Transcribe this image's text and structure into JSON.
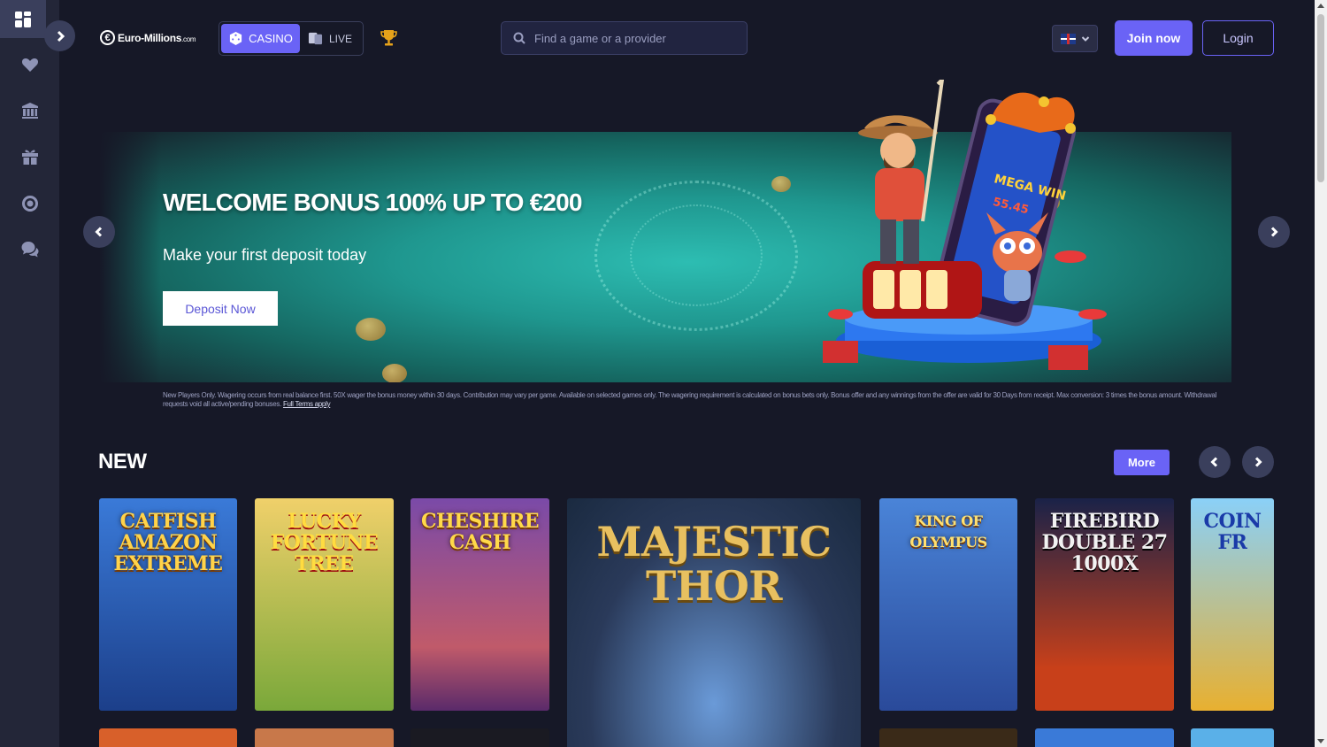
{
  "header": {
    "logo_mark": "€",
    "logo_text": "Euro-Millions",
    "logo_suffix": ".com",
    "mode_casino": "CASINO",
    "mode_live": "LIVE",
    "search_placeholder": "Find a game or a provider",
    "language": "en-GB",
    "join_label": "Join now",
    "login_label": "Login"
  },
  "sidebar": {
    "items": [
      {
        "icon": "dashboard-icon"
      },
      {
        "icon": "heart-icon"
      },
      {
        "icon": "casino-building-icon"
      },
      {
        "icon": "gift-icon"
      },
      {
        "icon": "target-icon"
      },
      {
        "icon": "support-chat-icon"
      }
    ]
  },
  "banner": {
    "title": "WELCOME BONUS 100% UP TO €200",
    "subtitle": "Make your first deposit today",
    "cta_label": "Deposit Now",
    "terms": "New Players Only. Wagering occurs from real balance first. 50X wager the bonus money within 30 days. Contribution may vary per game. Available on selected games only. The wagering requirement is calculated on bonus bets only. Bonus offer and any winnings from the offer are valid for 30 Days from receipt. Max conversion: 3 times the bonus amount. Withdrawal requests void all active/pending bonuses.",
    "terms_link": "Full Terms apply"
  },
  "section_new": {
    "title": "NEW",
    "more_label": "More",
    "games": [
      {
        "name": "CATFISH AMAZON EXTREME",
        "bg": "#2a5aa8",
        "accent": "#e8852a"
      },
      {
        "name": "LUCKY FORTUNE TREE",
        "bg": "#d7a23a",
        "accent": "#c92b2b"
      },
      {
        "name": "CHESHIRE CASH",
        "bg": "#7a3a8a",
        "accent": "#e02040"
      },
      {
        "name": "MAJESTIC THOR",
        "bg": "#2a4a6a",
        "accent": "#6fb6e8"
      },
      {
        "name": "KING OF OLYMPUS",
        "bg": "#3a64b0",
        "accent": "#e8c060"
      },
      {
        "name": "FIREBIRD DOUBLE 27 1000X",
        "bg": "#1e2a52",
        "accent": "#e85a20"
      },
      {
        "name": "COIN FR",
        "bg": "#6ab7e6",
        "accent": "#f0b020"
      }
    ]
  }
}
